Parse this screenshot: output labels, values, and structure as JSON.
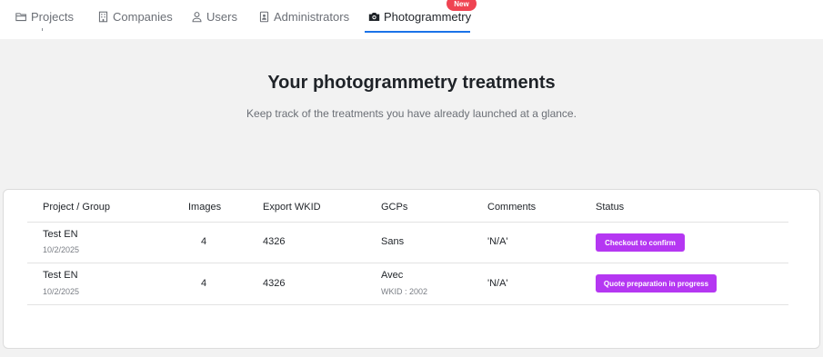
{
  "nav": {
    "tabs": [
      {
        "label": "Projects",
        "icon": "folder-icon"
      },
      {
        "label": "Companies",
        "icon": "building-icon"
      },
      {
        "label": "Users",
        "icon": "user-icon"
      },
      {
        "label": "Administrators",
        "icon": "admin-badge-icon"
      },
      {
        "label": "Photogrammetry",
        "icon": "camera-icon",
        "active": true
      }
    ],
    "new_badge": "New"
  },
  "main": {
    "title": "Your photogrammetry treatments",
    "subtitle": "Keep track of the treatments you have already launched at a glance."
  },
  "table": {
    "columns": [
      "Project / Group",
      "Images",
      "Export WKID",
      "GCPs",
      "Comments",
      "Status"
    ],
    "rows": [
      {
        "project": "Test EN",
        "date": "10/2/2025",
        "images": "4",
        "wkid": "4326",
        "gcps": "Sans",
        "gcps_wkid": "",
        "comments": "'N/A'",
        "status": "Checkout to confirm"
      },
      {
        "project": "Test EN",
        "date": "10/2/2025",
        "images": "4",
        "wkid": "4326",
        "gcps": "Avec",
        "gcps_wkid": "WKID : 2002",
        "comments": "'N/A'",
        "status": "Quote preparation in progress"
      }
    ]
  },
  "colors": {
    "accent": "#1a73e8",
    "status_button": "#b537f2",
    "badge": "#ef4452",
    "background": "#f2f2f2"
  }
}
